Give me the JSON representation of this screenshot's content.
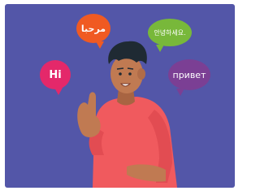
{
  "bubbles": {
    "arabic": "مرحبا",
    "korean": "안녕하세요.",
    "english": "Hi",
    "russian": "привет"
  },
  "colors": {
    "background": "#5356a8",
    "arabic_bubble": "#f05a22",
    "korean_bubble": "#78b83a",
    "english_bubble": "#e4286a",
    "russian_bubble": "#7b3f94",
    "shirt": "#f05a5e",
    "skin": "#c07a52",
    "hair": "#1f2a33"
  },
  "icons": [
    "speech-bubble",
    "person-illustration"
  ]
}
